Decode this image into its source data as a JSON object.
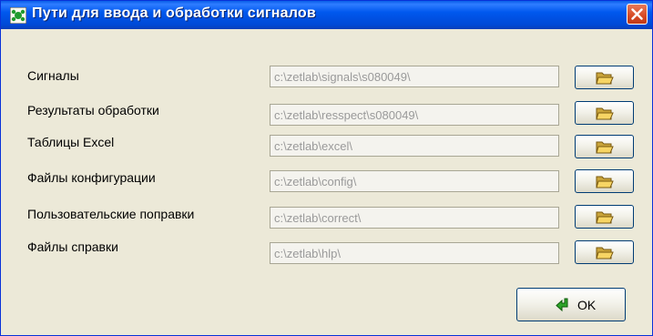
{
  "window": {
    "title": "Пути для ввода и обработки сигналов",
    "close_label": "×"
  },
  "rows": [
    {
      "label": "Сигналы",
      "value": "c:\\zetlab\\signals\\s080049\\"
    },
    {
      "label": "Результаты обработки",
      "value": "c:\\zetlab\\resspect\\s080049\\"
    },
    {
      "label": "Таблицы Excel",
      "value": "c:\\zetlab\\excel\\"
    },
    {
      "label": "Файлы конфигурации",
      "value": "c:\\zetlab\\config\\"
    },
    {
      "label": "Пользовательские поправки",
      "value": "c:\\zetlab\\correct\\"
    },
    {
      "label": "Файлы справки",
      "value": "c:\\zetlab\\hlp\\"
    }
  ],
  "buttons": {
    "browse_icon": "folder-open-icon",
    "ok_label": "OK",
    "ok_icon": "green-arrow-icon"
  },
  "colors": {
    "titlebar": "#0058ee",
    "close": "#d64a24",
    "dialog_bg": "#ece9d8",
    "field_text": "#9a9a9a"
  }
}
